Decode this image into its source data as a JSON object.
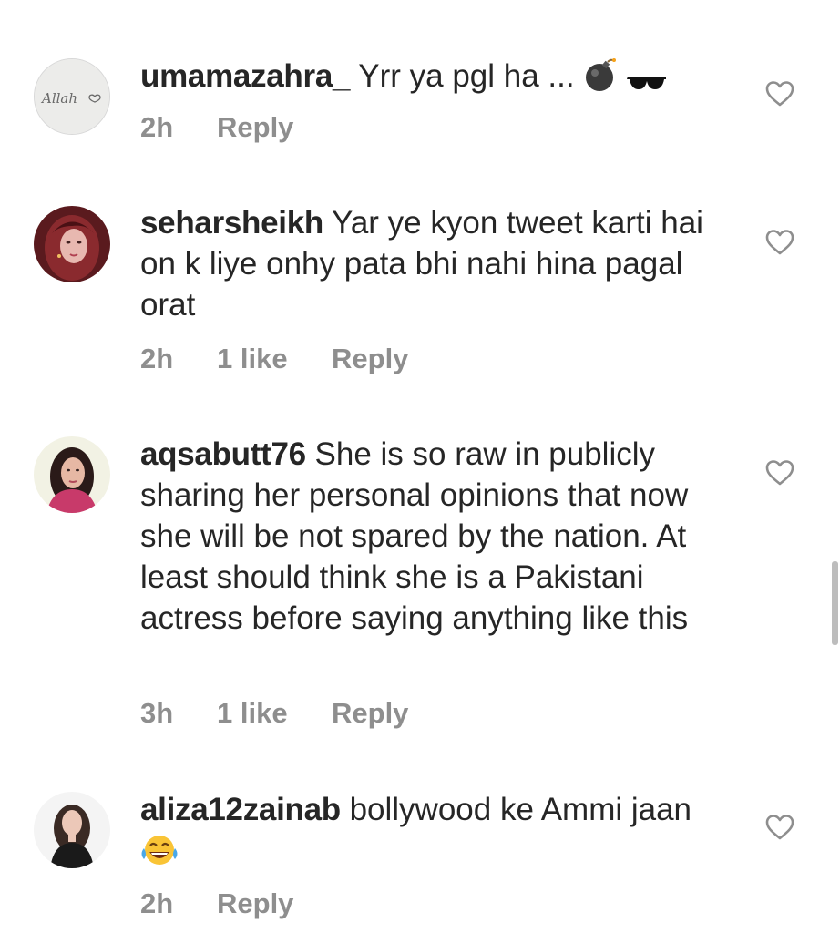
{
  "comments": [
    {
      "username": "umamazahra_",
      "text": "Yrr ya pgl ha ...",
      "time": "2h",
      "likes": "",
      "reply": "Reply",
      "avatar_text": "Allah"
    },
    {
      "username": "seharsheikh",
      "text": "Yar ye kyon tweet karti hai on k liye onhy pata bhi nahi hina pagal orat",
      "time": "2h",
      "likes": "1 like",
      "reply": "Reply"
    },
    {
      "username": "aqsabutt76",
      "text": "She is so raw in publicly sharing her personal opinions that now she will be not spared by the nation. At least should think she is a Pakistani actress before saying anything like this",
      "time": "3h",
      "likes": "1 like",
      "reply": "Reply"
    },
    {
      "username": "aliza12zainab",
      "text": "bollywood ke Ammi jaan",
      "time": "2h",
      "likes": "",
      "reply": "Reply"
    }
  ],
  "colors": {
    "text": "#262626",
    "meta": "#8e8e8e",
    "icon": "#8e8e8e"
  },
  "icons": [
    "heart-outline-icon",
    "bomb-emoji",
    "sunglasses-emoji",
    "tears-of-joy-emoji"
  ]
}
